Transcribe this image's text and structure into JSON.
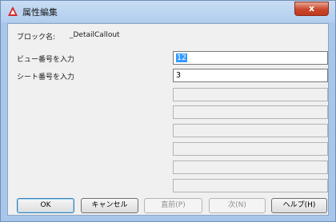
{
  "window": {
    "title": "属性編集",
    "close_label": "x"
  },
  "fields": {
    "block_name_label": "ブロック名:",
    "block_name_value": "_DetailCallout",
    "view_number_label": "ビュー番号を入力",
    "view_number_value": "12",
    "sheet_number_label": "シート番号を入力",
    "sheet_number_value": "3"
  },
  "buttons": {
    "ok": "OK",
    "cancel": "キャンセル",
    "prev": "直前(P)",
    "next": "次(N)",
    "help": "ヘルプ(H)"
  },
  "colors": {
    "app_icon": "#d8262c",
    "selection": "#3399ff"
  }
}
